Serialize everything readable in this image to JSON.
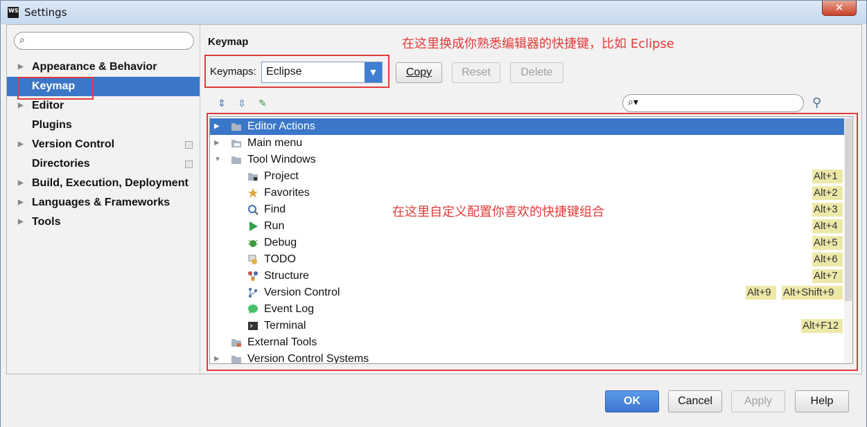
{
  "window": {
    "app_icon_text": "WS",
    "title": "Settings",
    "close_glyph": "✕"
  },
  "sidebar": {
    "search_placeholder": "",
    "items": [
      {
        "label": "Appearance & Behavior",
        "expandable": true
      },
      {
        "label": "Keymap",
        "expandable": false,
        "selected": true
      },
      {
        "label": "Editor",
        "expandable": true
      },
      {
        "label": "Plugins",
        "expandable": false
      },
      {
        "label": "Version Control",
        "expandable": true,
        "project_icon": true
      },
      {
        "label": "Directories",
        "expandable": false,
        "project_icon": true
      },
      {
        "label": "Build, Execution, Deployment",
        "expandable": true
      },
      {
        "label": "Languages & Frameworks",
        "expandable": true
      },
      {
        "label": "Tools",
        "expandable": true
      }
    ]
  },
  "main": {
    "title": "Keymap",
    "keymaps_label": "Keymaps:",
    "keymap_selected": "Eclipse",
    "buttons": {
      "copy": "Copy",
      "reset": "Reset",
      "delete": "Delete"
    },
    "tree_search_placeholder": ""
  },
  "tree": {
    "rows": [
      {
        "label": "Editor Actions",
        "level": 0,
        "state": "collapsed",
        "icon": "folder-icon",
        "selected": true,
        "shortcuts": []
      },
      {
        "label": "Main menu",
        "level": 0,
        "state": "collapsed",
        "icon": "menu-folder-icon",
        "shortcuts": []
      },
      {
        "label": "Tool Windows",
        "level": 0,
        "state": "expanded",
        "icon": "folder-icon",
        "shortcuts": []
      },
      {
        "label": "Project",
        "level": 1,
        "icon": "project-icon",
        "shortcuts": [
          "Alt+1"
        ]
      },
      {
        "label": "Favorites",
        "level": 1,
        "icon": "star-icon",
        "shortcuts": [
          "Alt+2"
        ]
      },
      {
        "label": "Find",
        "level": 1,
        "icon": "find-icon",
        "shortcuts": [
          "Alt+3"
        ]
      },
      {
        "label": "Run",
        "level": 1,
        "icon": "run-icon",
        "shortcuts": [
          "Alt+4"
        ]
      },
      {
        "label": "Debug",
        "level": 1,
        "icon": "debug-icon",
        "shortcuts": [
          "Alt+5"
        ]
      },
      {
        "label": "TODO",
        "level": 1,
        "icon": "todo-icon",
        "shortcuts": [
          "Alt+6"
        ]
      },
      {
        "label": "Structure",
        "level": 1,
        "icon": "structure-icon",
        "shortcuts": [
          "Alt+7"
        ]
      },
      {
        "label": "Version Control",
        "level": 1,
        "icon": "branch-icon",
        "shortcuts": [
          "Alt+9",
          "Alt+Shift+9"
        ]
      },
      {
        "label": "Event Log",
        "level": 1,
        "icon": "event-log-icon",
        "shortcuts": []
      },
      {
        "label": "Terminal",
        "level": 1,
        "icon": "terminal-icon",
        "shortcuts": [
          "Alt+F12"
        ]
      },
      {
        "label": "External Tools",
        "level": 0,
        "state": "leaf",
        "icon": "tools-folder-icon",
        "shortcuts": []
      },
      {
        "label": "Version Control Systems",
        "level": 0,
        "state": "collapsed",
        "icon": "folder-icon",
        "shortcuts": []
      }
    ]
  },
  "annotations": {
    "top": "在这里换成你熟悉编辑器的快捷键，比如 Eclipse",
    "middle": "在这里自定义配置你喜欢的快捷键组合",
    "color": "#e23a3a"
  },
  "footer": {
    "ok": "OK",
    "cancel": "Cancel",
    "apply": "Apply",
    "help": "Help"
  },
  "colors": {
    "selection": "#3a77c9",
    "shortcut_bg": "#eee8a8",
    "primary_button": "#3d78cf"
  }
}
